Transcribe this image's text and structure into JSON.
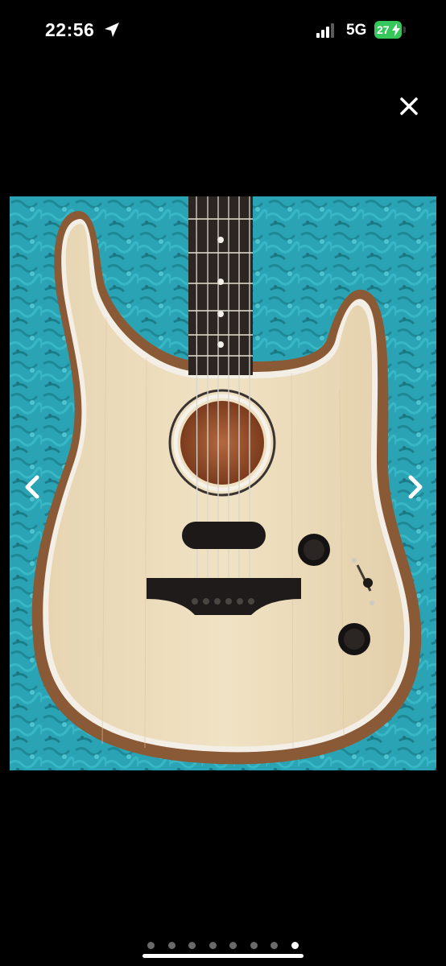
{
  "status_bar": {
    "time": "22:56",
    "network": "5G",
    "battery": "27"
  },
  "icons": {
    "location": "location-arrow-icon",
    "signal": "cellular-signal-icon",
    "charging": "charging-bolt-icon",
    "close": "close-icon",
    "prev": "chevron-left-icon",
    "next": "chevron-right-icon"
  },
  "colors": {
    "background": "#000000",
    "battery": "#35c759",
    "backdrop": "#2aa4b4",
    "top_wood": "#e9d8b8",
    "side_wood": "#8a5a36"
  },
  "gallery": {
    "total_images": 8,
    "current_index": 8
  }
}
